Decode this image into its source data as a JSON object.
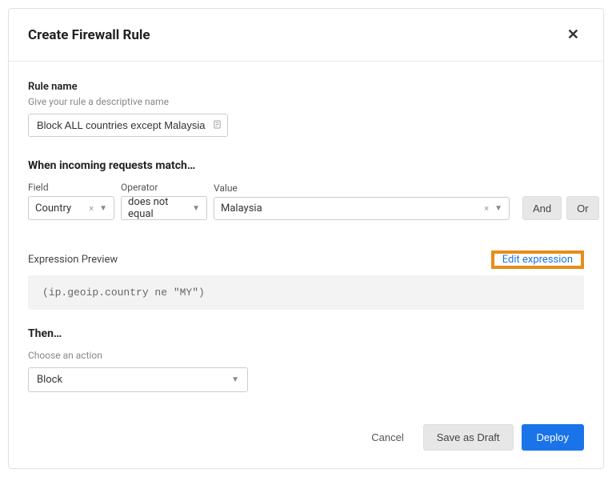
{
  "header": {
    "title": "Create Firewall Rule"
  },
  "rule_name": {
    "label": "Rule name",
    "desc": "Give your rule a descriptive name",
    "value": "Block ALL countries except Malaysia"
  },
  "match": {
    "heading": "When incoming requests match…",
    "field_label": "Field",
    "operator_label": "Operator",
    "value_label": "Value",
    "field": "Country",
    "operator": "does not equal",
    "value": "Malaysia",
    "and_label": "And",
    "or_label": "Or"
  },
  "expression": {
    "label": "Expression Preview",
    "edit_label": "Edit expression",
    "code": "(ip.geoip.country ne \"MY\")"
  },
  "then": {
    "heading": "Then…",
    "desc": "Choose an action",
    "action": "Block"
  },
  "footer": {
    "cancel": "Cancel",
    "draft": "Save as Draft",
    "deploy": "Deploy"
  }
}
